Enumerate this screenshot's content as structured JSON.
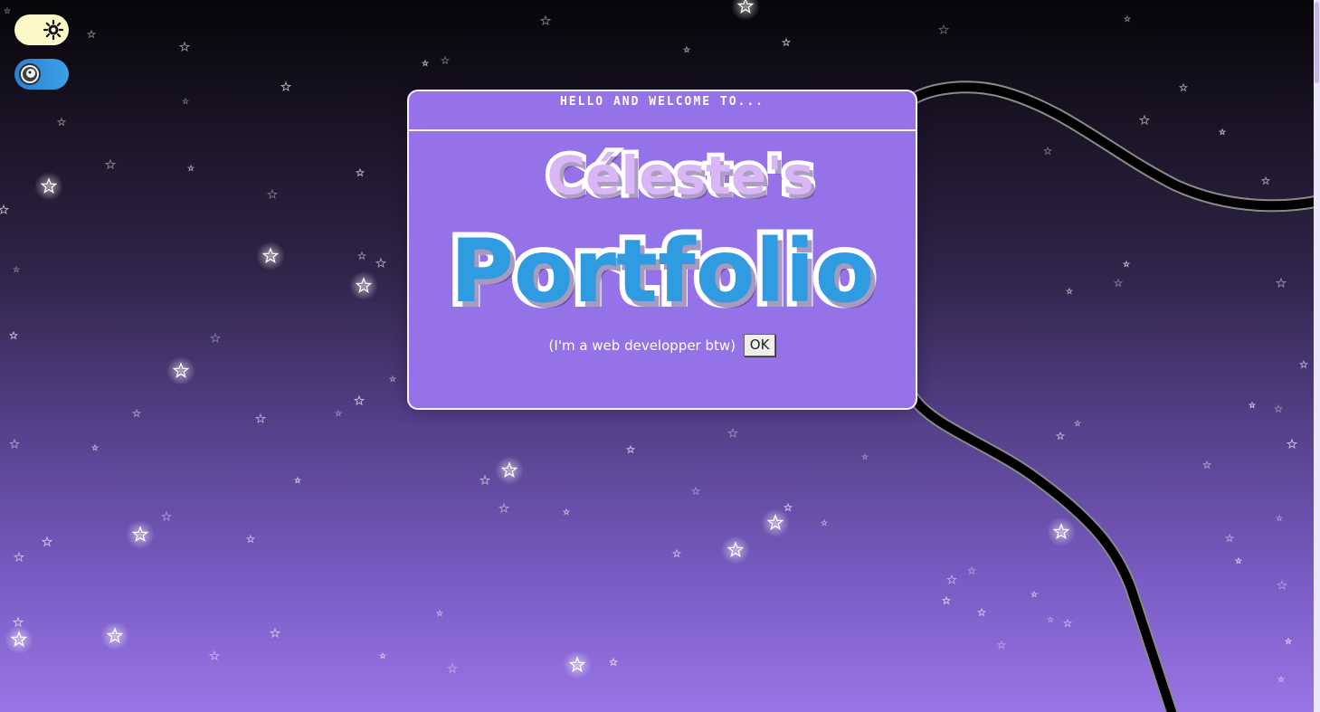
{
  "background": {
    "colors": {
      "top": "#060508",
      "bottom": "#9a75e6",
      "wire": "#000000",
      "wire_highlight": "#8a8a8a",
      "star": "#ffffff"
    },
    "decoration": [
      "star-icon",
      "cable-line"
    ]
  },
  "toggles": {
    "theme": {
      "icon": "sun-icon",
      "color": "#fdf8c8"
    },
    "sound": {
      "icon": "avatar-icon",
      "color": "#3aa2e6"
    }
  },
  "dialog": {
    "header_text": "HELLO AND WELCOME TO...",
    "title_line1": "Céleste's",
    "title_line2": "Portfolio",
    "tagline": "(I'm a web developper btw)",
    "ok_button_label": "OK",
    "colors": {
      "panel": "#9672e8",
      "border": "#f7f2ff",
      "title1": "#d9b6f6",
      "title2": "#2f9be0"
    }
  }
}
